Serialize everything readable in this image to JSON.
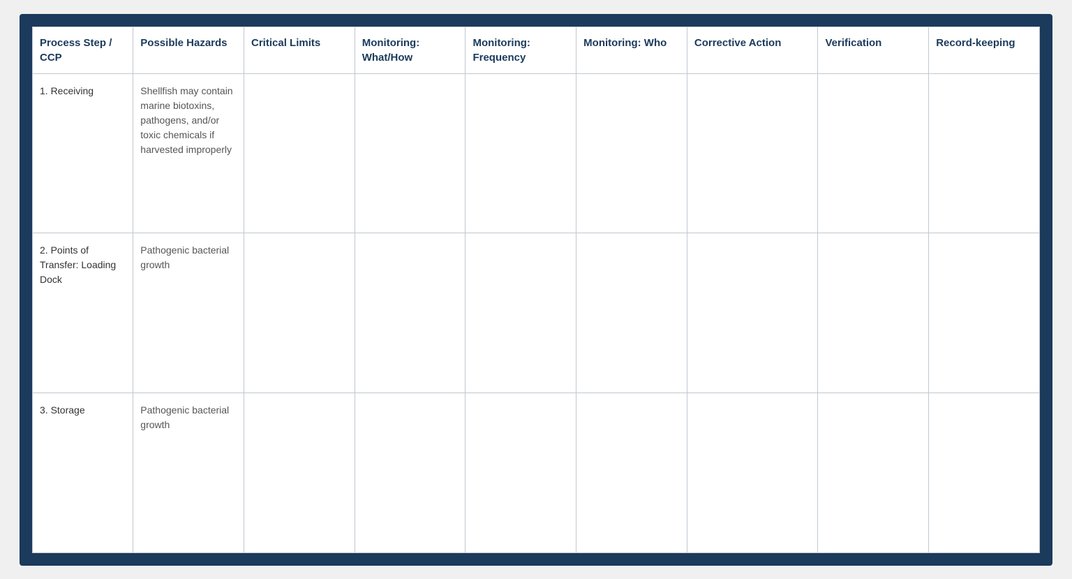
{
  "table": {
    "headers": [
      {
        "id": "process-step",
        "label": "Process Step / CCP"
      },
      {
        "id": "possible-hazards",
        "label": "Possible Hazards"
      },
      {
        "id": "critical-limits",
        "label": "Critical Limits"
      },
      {
        "id": "monitoring-what",
        "label": "Monitoring: What/How"
      },
      {
        "id": "monitoring-frequency",
        "label": "Monitoring: Frequency"
      },
      {
        "id": "monitoring-who",
        "label": "Monitoring: Who"
      },
      {
        "id": "corrective-action",
        "label": "Corrective Action"
      },
      {
        "id": "verification",
        "label": "Verification"
      },
      {
        "id": "recordkeeping",
        "label": "Record-keeping"
      }
    ],
    "rows": [
      {
        "process_step": "1.    Receiving",
        "possible_hazards": "Shellfish may contain marine biotoxins, pathogens, and/or toxic chemicals if harvested improperly",
        "critical_limits": "",
        "monitoring_what": "",
        "monitoring_frequency": "",
        "monitoring_who": "",
        "corrective_action": "",
        "verification": "",
        "recordkeeping": ""
      },
      {
        "process_step": "2.    Points of Transfer: Loading Dock",
        "possible_hazards": "Pathogenic bacterial growth",
        "critical_limits": "",
        "monitoring_what": "",
        "monitoring_frequency": "",
        "monitoring_who": "",
        "corrective_action": "",
        "verification": "",
        "recordkeeping": ""
      },
      {
        "process_step": "3.    Storage",
        "possible_hazards": "Pathogenic bacterial growth",
        "critical_limits": "",
        "monitoring_what": "",
        "monitoring_frequency": "",
        "monitoring_who": "",
        "corrective_action": "",
        "verification": "",
        "recordkeeping": ""
      }
    ]
  }
}
